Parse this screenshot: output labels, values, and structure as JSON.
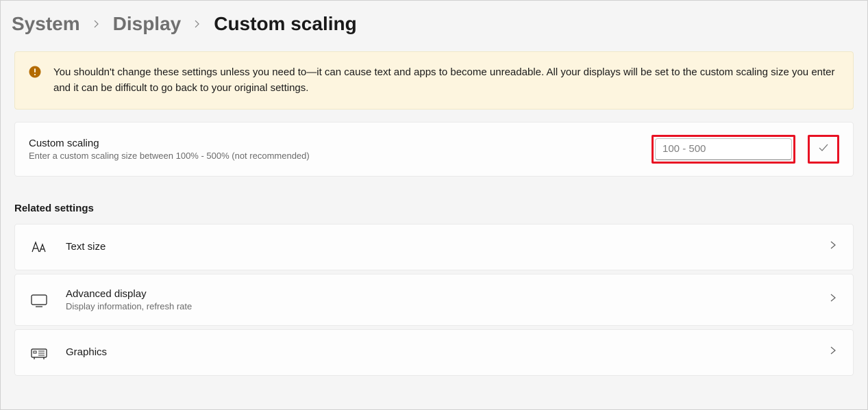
{
  "breadcrumb": {
    "items": [
      "System",
      "Display"
    ],
    "current": "Custom scaling"
  },
  "warning": {
    "text": "You shouldn't change these settings unless you need to—it can cause text and apps to become unreadable. All your displays will be set to the custom scaling size you enter and it can be difficult to go back to your original settings."
  },
  "scaling": {
    "title": "Custom scaling",
    "subtitle": "Enter a custom scaling size between 100% - 500% (not recommended)",
    "placeholder": "100 - 500",
    "value": ""
  },
  "related": {
    "header": "Related settings",
    "items": [
      {
        "icon": "text-size",
        "title": "Text size",
        "subtitle": ""
      },
      {
        "icon": "display",
        "title": "Advanced display",
        "subtitle": "Display information, refresh rate"
      },
      {
        "icon": "graphics",
        "title": "Graphics",
        "subtitle": ""
      }
    ]
  }
}
